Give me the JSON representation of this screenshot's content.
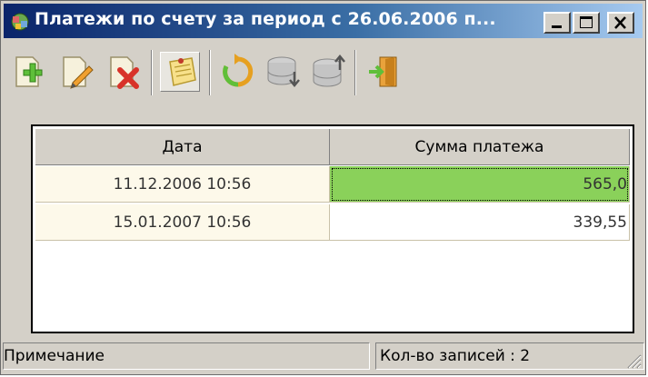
{
  "window": {
    "title": "Платежи по счету за период с 26.06.2006 п..."
  },
  "toolbar": {
    "icons": [
      "add-icon",
      "edit-icon",
      "delete-icon",
      "note-icon",
      "refresh-icon",
      "db-import-icon",
      "db-export-icon",
      "exit-icon"
    ]
  },
  "grid": {
    "columns": [
      "Дата",
      "Сумма платежа"
    ],
    "rows": [
      {
        "date": "11.12.2006 10:56",
        "amount": "565,0"
      },
      {
        "date": "15.01.2007 10:56",
        "amount": "339,55"
      }
    ]
  },
  "status": {
    "note": "Примечание",
    "count": "Кол-во записей : 2"
  },
  "colors": {
    "selected_cell": "#8ad15a",
    "row_fill": "#fdf9ea",
    "title_start": "#0a246a",
    "title_end": "#a6caf0"
  }
}
